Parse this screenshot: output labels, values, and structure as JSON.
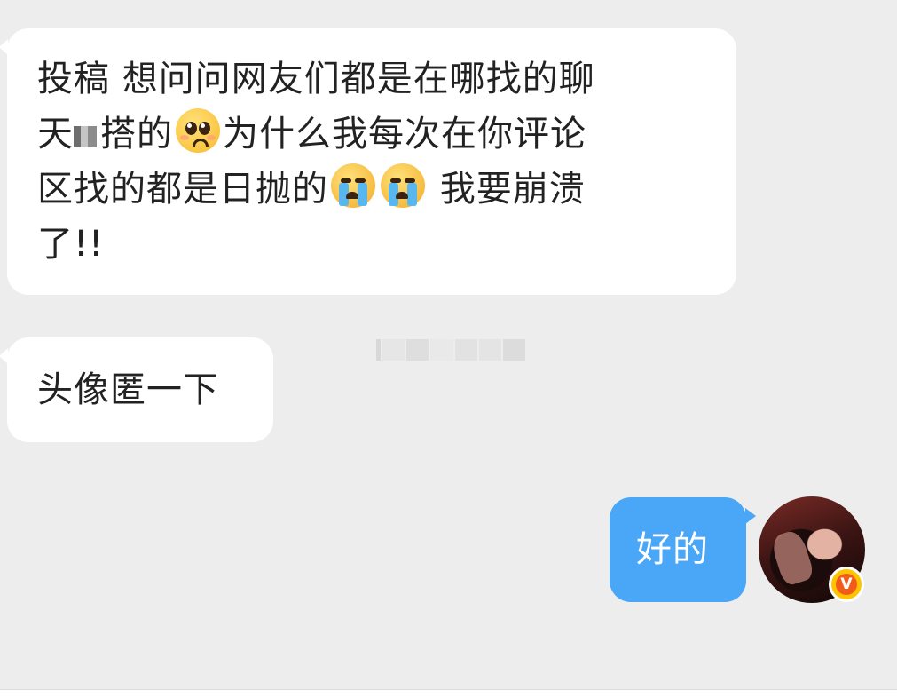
{
  "messages": [
    {
      "side": "left",
      "line1": "投稿 想问问网友们都是在哪找的聊",
      "line2_a": "天",
      "line2_b": "搭的",
      "line2_c": "为什么我每次在你评论",
      "line3_a": "区找的都是日抛的",
      "line3_b": " 我要崩溃",
      "line4": "了!!",
      "emojis": [
        "pleading-face-icon",
        "loudly-crying-face-icon",
        "loudly-crying-face-icon"
      ]
    },
    {
      "side": "left",
      "text": "头像匿一下"
    },
    {
      "side": "right",
      "text": "好的"
    }
  ],
  "avatar": {
    "badge": "V"
  },
  "colors": {
    "background": "#ededed",
    "incoming_bubble": "#ffffff",
    "outgoing_bubble": "#4aa6f7",
    "badge_outer": "#ffc300",
    "badge_inner": "#f35b1b"
  }
}
